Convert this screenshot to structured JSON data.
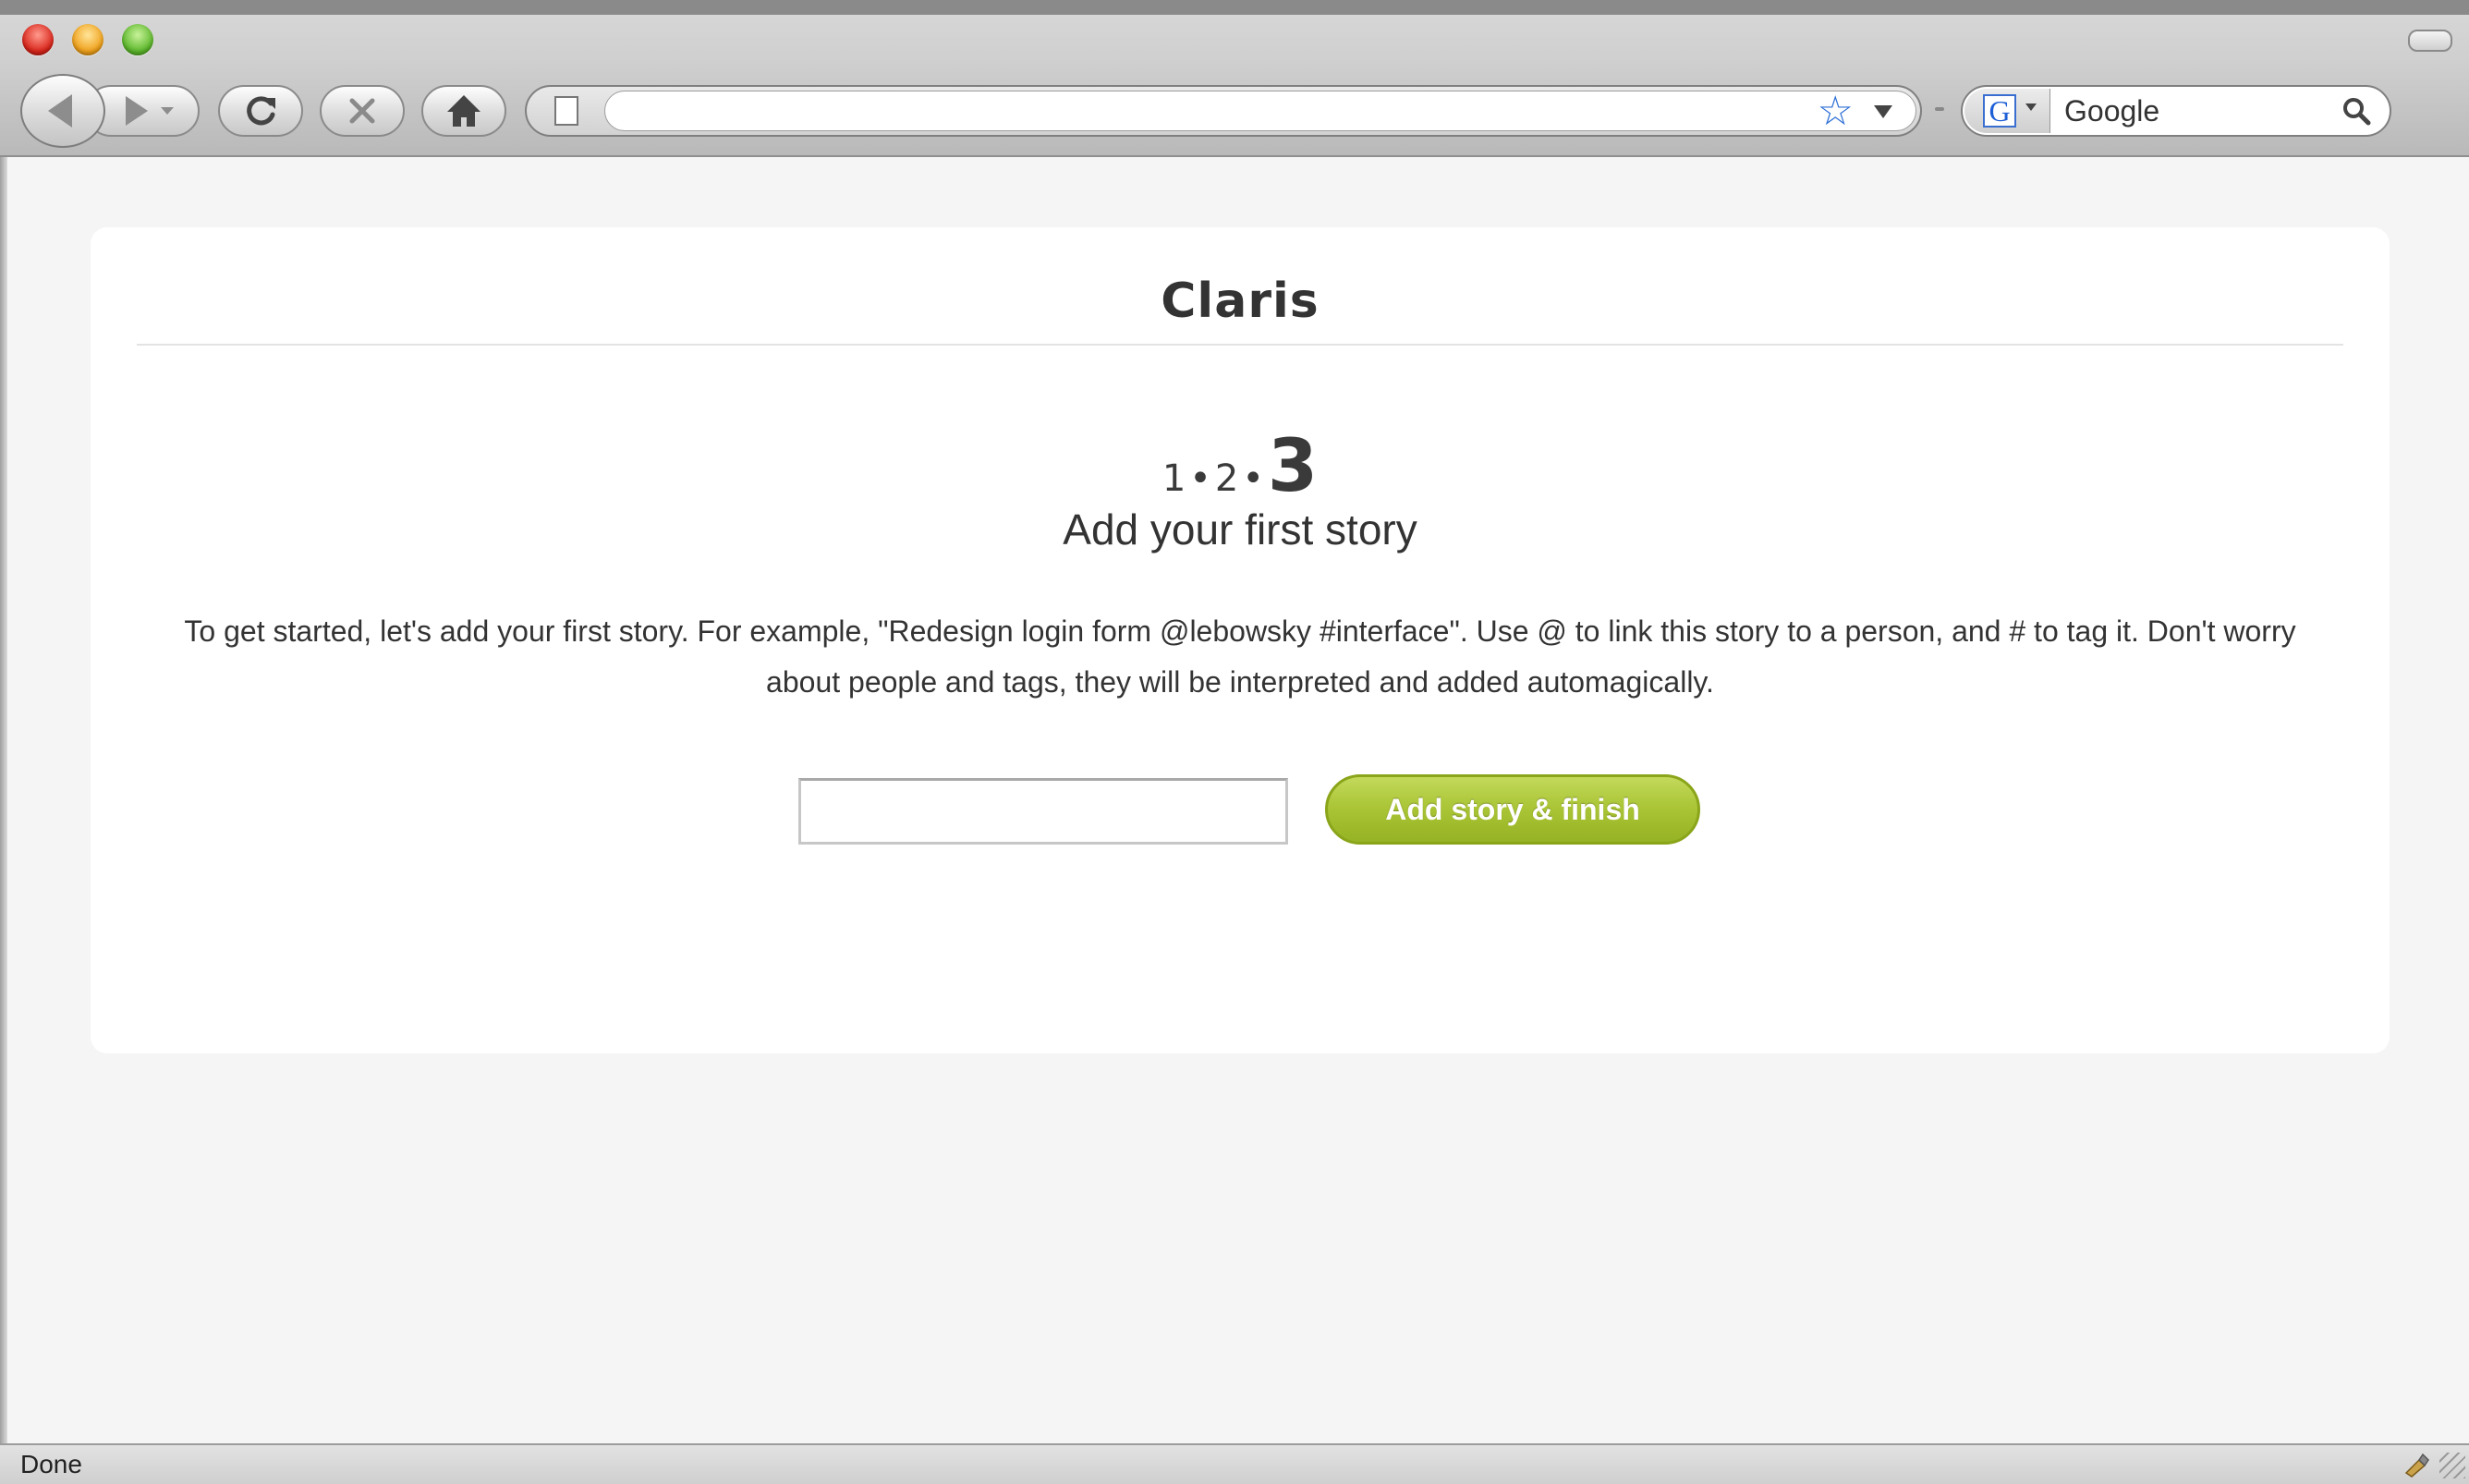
{
  "browser": {
    "url_value": "",
    "search_engine_label": "G",
    "search_placeholder": "Google",
    "status_text": "Done"
  },
  "page": {
    "brand": "Claris",
    "steps": {
      "step1": "1",
      "step2": "2",
      "step3": "3",
      "separator": "•"
    },
    "step_title": "Add your first story",
    "description": "To get started, let's add your first story. For example, \"Redesign login form @lebowsky #interface\". Use @ to link this story to a person, and # to tag it. Don't worry about people and tags, they will be interpreted and added automagically.",
    "story_input_value": "",
    "finish_button_label": "Add story & finish"
  },
  "icons": {
    "back": "back-arrow-icon",
    "forward": "forward-arrow-icon",
    "reload": "reload-icon",
    "stop": "stop-icon",
    "home": "home-icon",
    "page": "page-icon",
    "bookmark": "star-icon",
    "search": "magnifier-icon",
    "status": "addon-icon"
  },
  "colors": {
    "button_green": "#a9c434",
    "star_blue": "#2d6fd6",
    "text_dark": "#333333"
  }
}
